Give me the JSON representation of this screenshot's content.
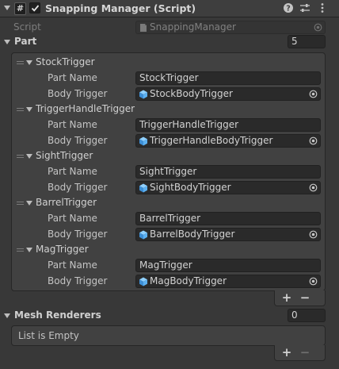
{
  "component": {
    "title": "Snapping Manager (Script)",
    "enabled": true
  },
  "script_field": {
    "label": "Script",
    "value": "SnappingManager"
  },
  "part": {
    "label": "Part",
    "count": "5",
    "field_labels": {
      "part_name": "Part Name",
      "body_trigger": "Body Trigger"
    },
    "items": [
      {
        "header": "StockTrigger",
        "part_name": "StockTrigger",
        "body_trigger": "StockBodyTrigger"
      },
      {
        "header": "TriggerHandleTrigger",
        "part_name": "TriggerHandleTrigger",
        "body_trigger": "TriggerHandleBodyTrigger"
      },
      {
        "header": "SightTrigger",
        "part_name": "SightTrigger",
        "body_trigger": "SightBodyTrigger"
      },
      {
        "header": "BarrelTrigger",
        "part_name": "BarrelTrigger",
        "body_trigger": "BarrelBodyTrigger"
      },
      {
        "header": "MagTrigger",
        "part_name": "MagTrigger",
        "body_trigger": "MagBodyTrigger"
      }
    ]
  },
  "mesh_renderers": {
    "label": "Mesh Renderers",
    "count": "0",
    "empty_text": "List is Empty"
  },
  "footer": {
    "add": "+",
    "remove": "−"
  },
  "colors": {
    "background": "#383838",
    "field": "#2a2a2a",
    "accent_cube": "#4fa8e8"
  }
}
